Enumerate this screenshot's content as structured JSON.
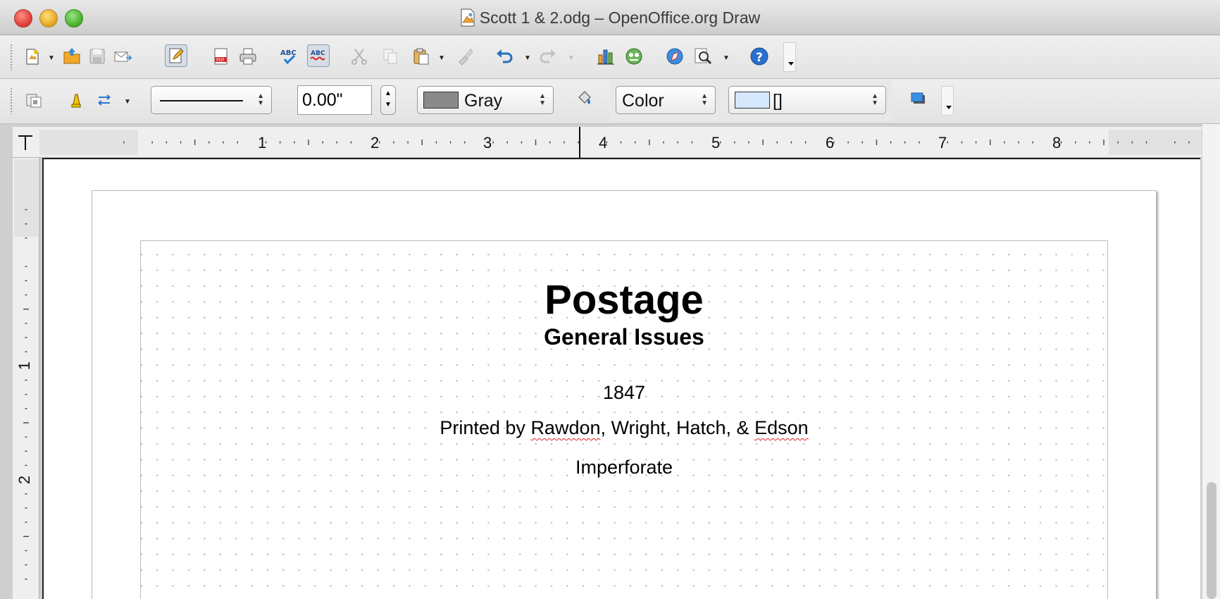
{
  "window": {
    "title": "Scott 1 & 2.odg – OpenOffice.org Draw"
  },
  "toolbar_standard": {
    "icons": [
      "new-icon",
      "open-folder-icon",
      "save-icon",
      "email-icon",
      "edit-file-icon",
      "export-pdf-icon",
      "print-icon",
      "spellcheck-icon",
      "autospellcheck-icon",
      "cut-icon",
      "copy-icon",
      "paste-icon",
      "clone-formatting-icon",
      "undo-icon",
      "redo-icon",
      "chart-icon",
      "gallery-icon",
      "navigator-icon",
      "zoom-icon",
      "help-icon"
    ]
  },
  "toolbar_line_fill": {
    "line_width": "0.00\"",
    "line_color": "Gray",
    "line_color_hex": "#8a8a8a",
    "area_style": "Color",
    "area_fill": "[]",
    "area_fill_hex": "#d6e8fb"
  },
  "ruler": {
    "h_labels": [
      "1",
      "2",
      "3",
      "4",
      "5",
      "6",
      "7",
      "8"
    ],
    "v_labels": [
      "1",
      "2"
    ]
  },
  "document": {
    "title": "Postage",
    "subtitle": "General Issues",
    "year": "1847",
    "printed_prefix": "Printed by ",
    "printer_1": "Rawdon",
    "printer_mid": ", Wright, Hatch, & ",
    "printer_2": "Edson",
    "perforation": "Imperforate"
  }
}
